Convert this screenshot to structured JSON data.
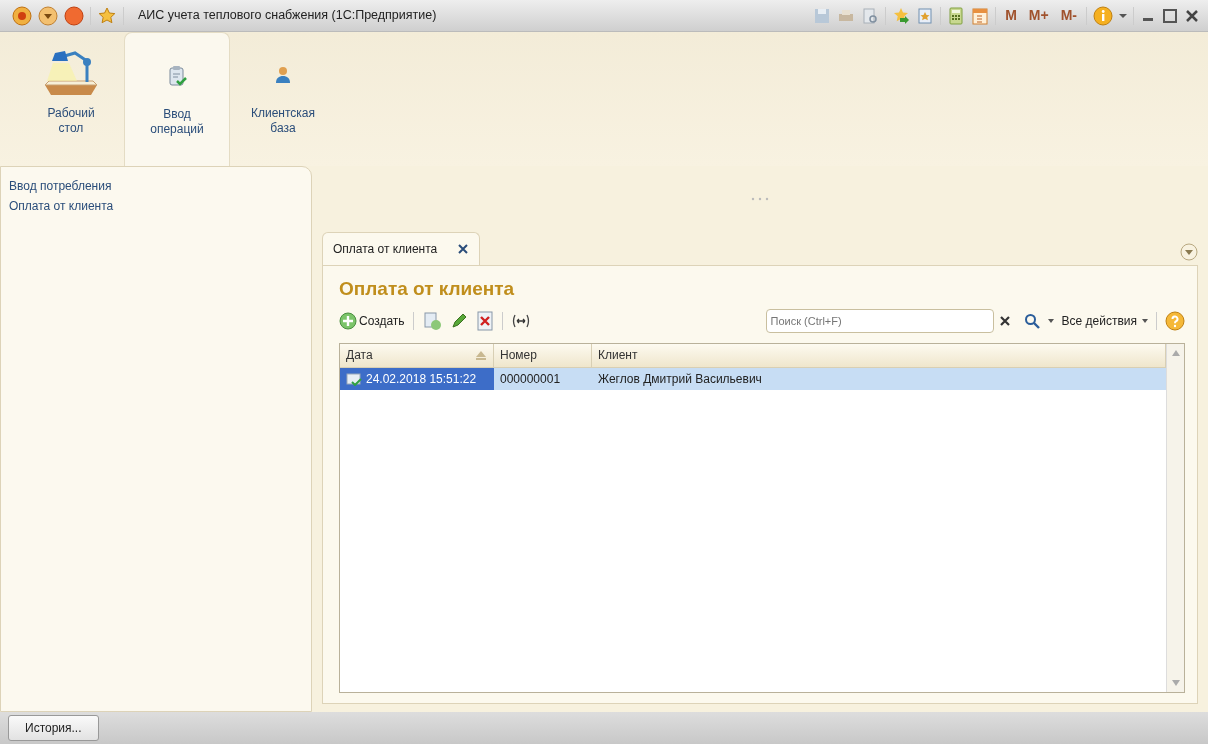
{
  "window": {
    "title": "АИС учета теплового снабжения  (1С:Предприятие)"
  },
  "memory_buttons": [
    "M",
    "M+",
    "M-"
  ],
  "sections": [
    {
      "lines": [
        "Рабочий",
        "стол"
      ],
      "selected": false
    },
    {
      "lines": [
        "Ввод",
        "операций"
      ],
      "selected": true
    },
    {
      "lines": [
        "Клиентская",
        "база"
      ],
      "selected": false
    }
  ],
  "nav_links": [
    "Ввод потребления",
    "Оплата от клиента"
  ],
  "open_tabs": [
    {
      "label": "Оплата от клиента",
      "selected": true
    }
  ],
  "form": {
    "title": "Оплата от клиента",
    "create_label": "Создать",
    "search": {
      "placeholder": "Поиск (Ctrl+F)"
    },
    "all_actions": "Все действия"
  },
  "table": {
    "columns": [
      {
        "label": "Дата",
        "sorted": true
      },
      {
        "label": "Номер",
        "sorted": false
      },
      {
        "label": "Клиент",
        "sorted": false
      }
    ],
    "rows": [
      {
        "cells": [
          "24.02.2018 15:51:22",
          "000000001",
          "Жеглов Дмитрий Васильевич"
        ],
        "selected": true
      }
    ]
  },
  "status_bar": {
    "history_button": "История..."
  }
}
